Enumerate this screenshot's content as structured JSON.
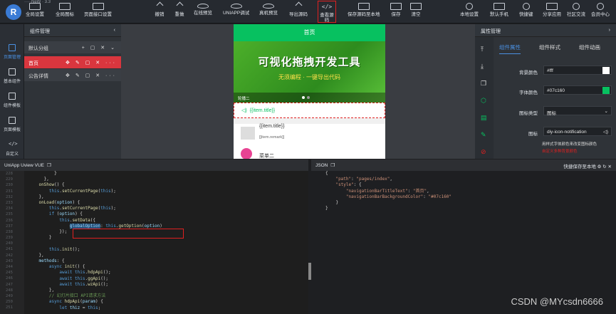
{
  "app": {
    "logo": "R",
    "logo_text": "·····NeW · 3.3"
  },
  "toolbar": {
    "left": [
      "全局设置",
      "全局图标",
      "页面接口设置"
    ],
    "center": [
      "撤销",
      "重做",
      "在线预览",
      "UNIAPP调试",
      "真机预览",
      "导出源码",
      "查看源码",
      "保存源码至本地",
      "保存",
      "清空"
    ],
    "right": [
      "本地设置",
      "默认手机",
      "快捷键",
      "分享应用",
      "社区交流",
      "会员中心"
    ]
  },
  "rail": [
    "页面管理",
    "基本组件",
    "组件模板",
    "页面模板",
    "自定义"
  ],
  "left_panel": {
    "title": "组件管理",
    "group": "默认分组",
    "items": [
      "首页",
      "公告详情"
    ]
  },
  "phone": {
    "title": "首页",
    "banner_title": "可视化拖拽开发工具",
    "banner_sub": "无须编程 · 一键导出代码",
    "dot_text": "轮播二",
    "notice": "{{item.title}}",
    "list_title": "{{item.title}}",
    "list_remark": "[[item.remark]]",
    "list2": "菜单二"
  },
  "right_panel": {
    "title": "属性管理",
    "tabs": [
      "组件属性",
      "组件样式",
      "组件动画"
    ],
    "props": [
      {
        "label": "背景颜色",
        "value": "#fff"
      },
      {
        "label": "字体颜色",
        "value": "#07c160"
      },
      {
        "label": "图标类型",
        "value": "图标"
      },
      {
        "label": "图标",
        "value": "diy-icon-notification"
      }
    ],
    "hint1": "用样式字体颜色来改变图标颜色",
    "hint2": "自定义多种背景颜色"
  },
  "colors": {
    "accent": "#07c160",
    "danger": "#e02020"
  },
  "editor": {
    "title": "UniApp Uview VUE",
    "lines_start": "228"
  },
  "json_panel": {
    "title": "JSON",
    "save_btn": "快捷保存至本地"
  },
  "watermark": "CSDN @MYcsdn6666"
}
